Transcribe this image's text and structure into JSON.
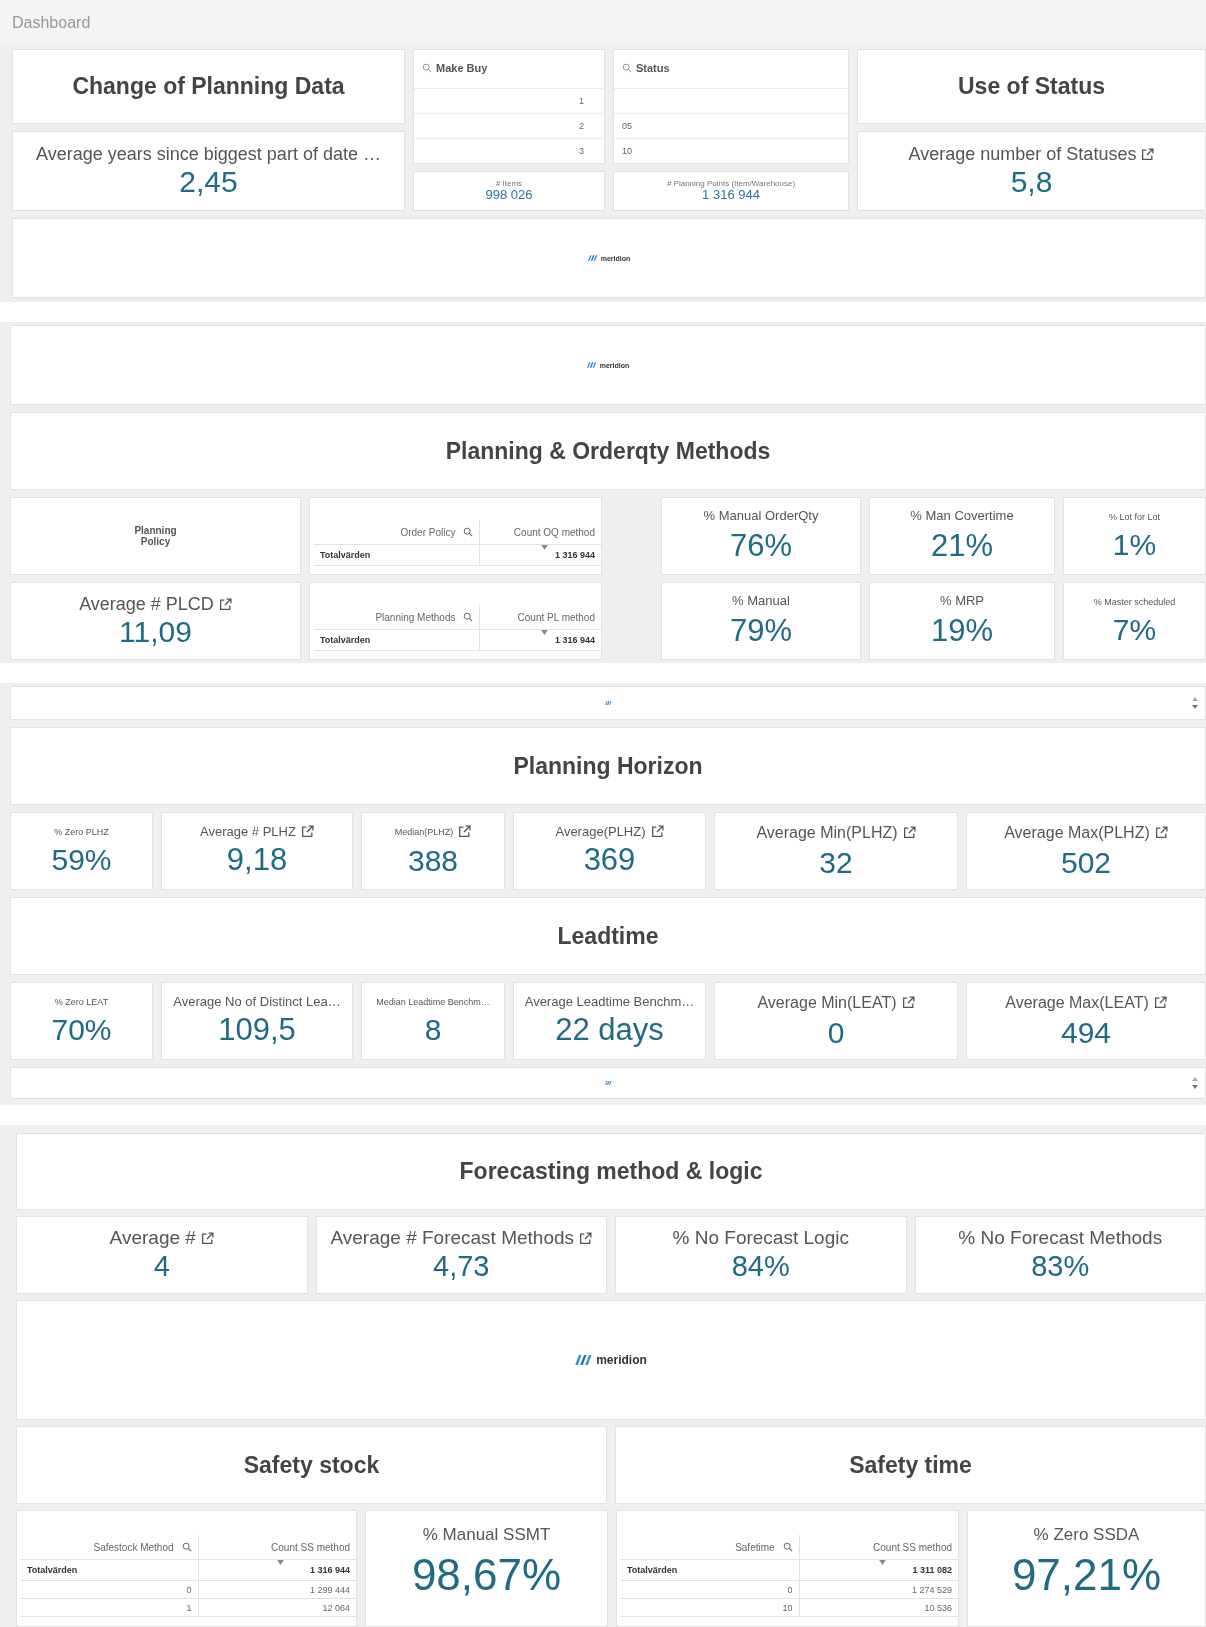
{
  "header": {
    "title": "Dashboard"
  },
  "overview": {
    "left": {
      "title": "Change of Planning Data",
      "kpi": {
        "label": "Average years since biggest part of date …",
        "value": "2,45"
      }
    },
    "filters": [
      {
        "label": "Make Buy",
        "rows": [
          {
            "kind": "number",
            "text": "1"
          },
          {
            "kind": "number",
            "text": "2"
          },
          {
            "kind": "number",
            "text": "3"
          }
        ],
        "kpi": {
          "label": "# Items",
          "value": "998 026"
        }
      },
      {
        "label": "Status",
        "rows": [
          {
            "kind": "blank"
          },
          {
            "kind": "value",
            "text": "05"
          },
          {
            "kind": "value",
            "text": "10"
          }
        ],
        "kpi": {
          "label": "# Planning Points (Item/Warehouse)",
          "value": "1 316 944"
        }
      }
    ],
    "right": {
      "title": "Use of Status",
      "kpi": {
        "label": "Average number of Statuses",
        "value": "5,8",
        "link": true
      }
    },
    "logo": {
      "kind": "small",
      "text": "meridion"
    }
  },
  "planning": {
    "logo": {
      "kind": "small",
      "text": "meridion"
    },
    "title": "Planning & Orderqty Methods",
    "policy": {
      "title": "Planning Policy"
    },
    "plcd": {
      "label": "Average # PLCD",
      "value": "11,09",
      "link": true
    },
    "tables": [
      {
        "columns": [
          {
            "label": "Order Policy",
            "search": true
          },
          {
            "label": "Count OQ method",
            "sorted": true
          }
        ],
        "total": {
          "label": "Totalvärden",
          "value": "1 316 944"
        }
      },
      {
        "columns": [
          {
            "label": "Planning Methods",
            "search": true
          },
          {
            "label": "Count PL method",
            "sorted": true
          }
        ],
        "total": {
          "label": "Totalvärden",
          "value": "1 316 944"
        }
      }
    ],
    "kpis": [
      {
        "label": "% Manual OrderQty",
        "value": "76%"
      },
      {
        "label": "% Man Covertime",
        "value": "21%"
      },
      {
        "label": "% Lot for Lot",
        "value": "1%"
      },
      {
        "label": "% Manual",
        "value": "79%"
      },
      {
        "label": "% MRP",
        "value": "19%"
      },
      {
        "label": "% Master scheduled",
        "value": "7%"
      }
    ]
  },
  "horizon": {
    "logo": {
      "kind": "tiny",
      "scroller": true
    },
    "groups": [
      {
        "title": "Planning Horizon",
        "kpis": [
          {
            "label": "% Zero PLHZ",
            "value": "59%"
          },
          {
            "label": "Average # PLHZ",
            "value": "9,18",
            "link": true
          },
          {
            "label": "Median(PLHZ)",
            "value": "388",
            "link": true
          },
          {
            "label": "Average(PLHZ)",
            "value": "369",
            "link": true
          },
          {
            "label": "Average Min(PLHZ)",
            "value": "32",
            "link": true
          },
          {
            "label": "Average Max(PLHZ)",
            "value": "502",
            "link": true
          }
        ]
      },
      {
        "title": "Leadtime",
        "kpis": [
          {
            "label": "% Zero LEAT",
            "value": "70%"
          },
          {
            "label": "Average No of Distinct Lea…",
            "value": "109,5"
          },
          {
            "label": "Median Leadtime Benchm…",
            "value": "8"
          },
          {
            "label": "Average Leadtime Benchm…",
            "value": "22 days"
          },
          {
            "label": "Average Min(LEAT)",
            "value": "0",
            "link": true
          },
          {
            "label": "Average Max(LEAT)",
            "value": "494",
            "link": true
          }
        ]
      }
    ],
    "footer_logo": {
      "kind": "tiny",
      "scroller": true
    }
  },
  "forecasting": {
    "title": "Forecasting method & logic",
    "kpis": [
      {
        "label": "Average #",
        "value": "4",
        "link": true
      },
      {
        "label": "Average # Forecast Methods",
        "value": "4,73",
        "link": true
      },
      {
        "label": "% No Forecast Logic",
        "value": "84%"
      },
      {
        "label": "% No Forecast Methods",
        "value": "83%"
      }
    ],
    "logo": {
      "kind": "large",
      "text": "meridion"
    },
    "panels": [
      {
        "title": "Safety stock",
        "table": {
          "columns": [
            {
              "label": "Safestock Method",
              "search": true
            },
            {
              "label": "Count SS method",
              "sorted": true
            }
          ],
          "total": {
            "label": "Totalvärden",
            "value": "1 316 944"
          },
          "rows": [
            [
              "0",
              "1 299 444"
            ],
            [
              "1",
              "12 064"
            ]
          ]
        },
        "kpi": {
          "label": "% Manual SSMT",
          "value": "98,67%"
        }
      },
      {
        "title": "Safety time",
        "table": {
          "columns": [
            {
              "label": "Safetime",
              "search": true
            },
            {
              "label": "Count SS method",
              "sorted": true
            }
          ],
          "total": {
            "label": "Totalvärden",
            "value": "1 311 082"
          },
          "rows": [
            [
              "0",
              "1 274 529"
            ],
            [
              "10",
              "10 536"
            ]
          ]
        },
        "kpi": {
          "label": "% Zero SSDA",
          "value": "97,21%"
        }
      }
    ]
  }
}
